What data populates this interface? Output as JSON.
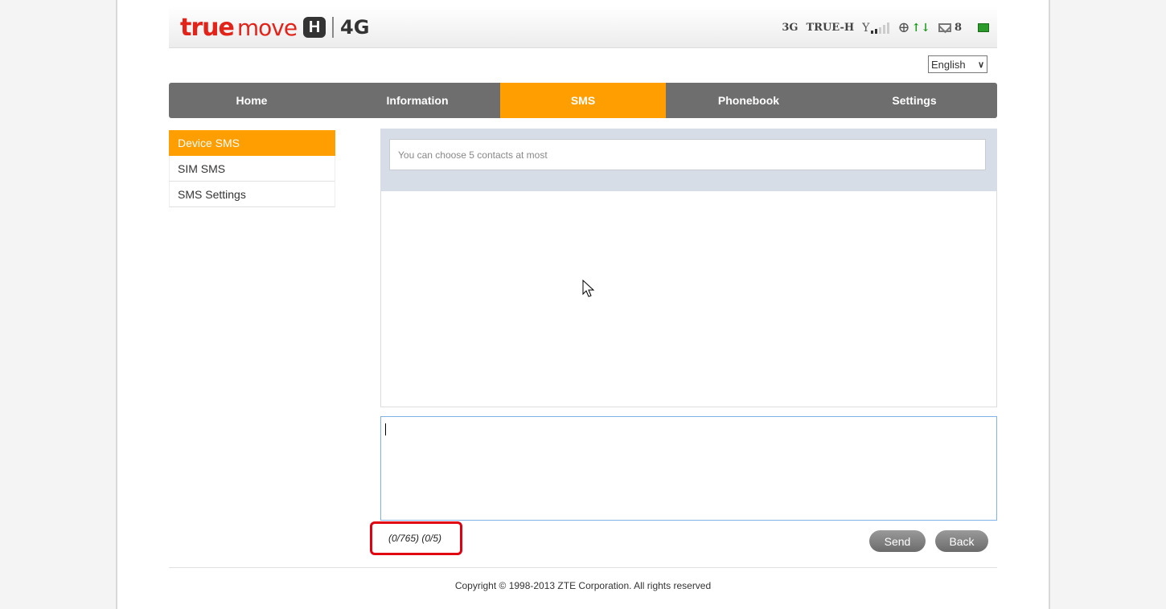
{
  "brand": {
    "true_text": "true",
    "move_text": "move",
    "h_badge": "H",
    "lte": "4G"
  },
  "status": {
    "network_type": "3G",
    "operator": "TRUE-H",
    "sms_count": "8",
    "signal_level": 2,
    "signal_max": 5
  },
  "language": {
    "selected": "English"
  },
  "nav": {
    "items": [
      {
        "label": "Home"
      },
      {
        "label": "Information"
      },
      {
        "label": "SMS"
      },
      {
        "label": "Phonebook"
      },
      {
        "label": "Settings"
      }
    ],
    "active_index": 2
  },
  "sidebar": {
    "items": [
      {
        "label": "Device SMS"
      },
      {
        "label": "SIM SMS"
      },
      {
        "label": "SMS Settings"
      }
    ]
  },
  "compose": {
    "contacts_placeholder": "You can choose 5 contacts at most",
    "counter": "(0/765) (0/5)",
    "send_label": "Send",
    "back_label": "Back"
  },
  "footer": {
    "copyright": "Copyright © 1998-2013 ZTE Corporation. All rights reserved"
  },
  "colors": {
    "accent": "#ff9e00",
    "nav_bg": "#6e6e6e",
    "brand_red": "#e2231a",
    "highlight_box": "#e00010"
  }
}
